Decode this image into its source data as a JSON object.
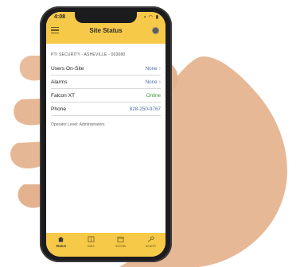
{
  "status_bar": {
    "time": "4:08",
    "icons": "▪ ◠ ▮"
  },
  "header": {
    "title": "Site Status"
  },
  "site_label": "PTI SECURITY - ASHEVILLE - 003080",
  "rows": [
    {
      "label": "Users On-Site",
      "value": "None",
      "chevron": true
    },
    {
      "label": "Alarms",
      "value": "None",
      "chevron": true
    },
    {
      "label": "Falcon XT",
      "value": "Online",
      "chevron": false
    },
    {
      "label": "Phone",
      "value": "828-250-9767",
      "chevron": false
    }
  ],
  "note": "Operator Level: Administrators",
  "tabs": [
    {
      "label": "Status",
      "icon": "home-icon",
      "active": true
    },
    {
      "label": "Gate",
      "icon": "gate-icon",
      "active": false
    },
    {
      "label": "Events",
      "icon": "calendar-icon",
      "active": false
    },
    {
      "label": "Search",
      "icon": "key-icon",
      "active": false
    }
  ],
  "colors": {
    "accent": "#f7c948",
    "link": "#4a6fa5",
    "online": "#3a9a3a"
  }
}
